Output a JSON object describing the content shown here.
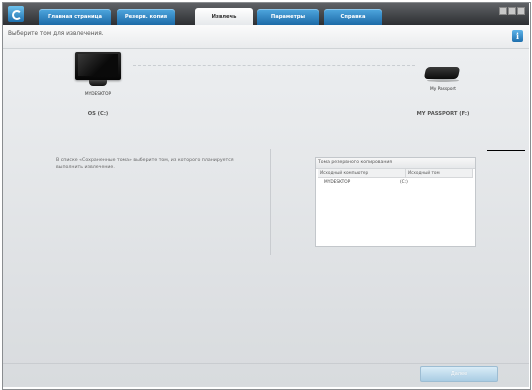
{
  "tabs": [
    {
      "label": "Главная страница"
    },
    {
      "label": "Резерв. копия"
    },
    {
      "label": "Извлечь"
    },
    {
      "label": "Параметры"
    },
    {
      "label": "Справка"
    }
  ],
  "active_tab": "Извлечь",
  "instruction": "Выберите том для извлечения.",
  "info_button": "i",
  "source": {
    "computer_name": "MYDESKTOP",
    "volume": "OS (C:)"
  },
  "destination": {
    "drive_name": "My Passport",
    "volume": "MY PASSPORT (F:)"
  },
  "description": "В списке «Сохраненные тома» выберите том, из которого планируется выполнить извлечение.",
  "volumes": {
    "title": "Тома резервного копирования",
    "columns": [
      "Исходный компьютер",
      "Исходный том"
    ],
    "rows": [
      {
        "computer": "MYDESKTOP",
        "volume": "(C:)"
      }
    ]
  },
  "restore_button": "Далее",
  "colors": {
    "tab_blue": "#2f86c7",
    "titlebar": "#3a3c40",
    "panel": "#e3e5e8"
  }
}
